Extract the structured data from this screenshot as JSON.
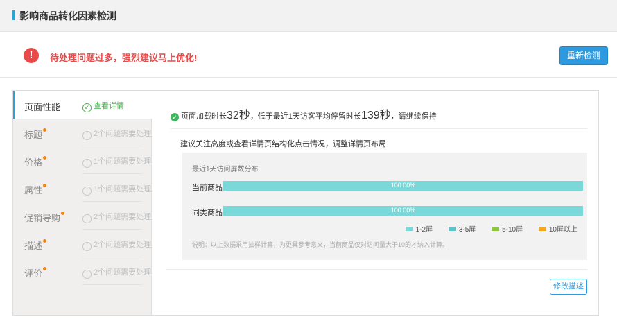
{
  "header": {
    "title": "影响商品转化因素检测",
    "accent_color": "#2aa3d8"
  },
  "alert": {
    "icon": "warning-icon",
    "message": "待处理问题过多，强烈建议马上优化!",
    "color": "#e84a4a",
    "recheck_label": "重新检测"
  },
  "sidebar": {
    "items": [
      {
        "label": "页面性能",
        "status": "查看详情",
        "active": true,
        "dot": false
      },
      {
        "label": "标题",
        "status": "2个问题需要处理",
        "active": false,
        "dot": true
      },
      {
        "label": "价格",
        "status": "1个问题需要处理",
        "active": false,
        "dot": true
      },
      {
        "label": "属性",
        "status": "1个问题需要处理",
        "active": false,
        "dot": true
      },
      {
        "label": "促销导购",
        "status": "2个问题需要处理",
        "active": false,
        "dot": true
      },
      {
        "label": "描述",
        "status": "2个问题需要处理",
        "active": false,
        "dot": true
      },
      {
        "label": "评价",
        "status": "2个问题需要处理",
        "active": false,
        "dot": true
      }
    ]
  },
  "main": {
    "summary": {
      "prefix": "页面加载时长",
      "load_time": "32秒",
      "middle": "，低于最近1天访客平均停留时长",
      "stay_time": "139秒",
      "suffix": "，请继续保持"
    },
    "advice": "建议关注高度或查看详情页结构化点击情况，调整详情页布局",
    "chart": {
      "title": "最近1天访问屏数分布",
      "rows": [
        {
          "label": "当前商品",
          "value_text": "100.00%"
        },
        {
          "label": "同类商品",
          "value_text": "100.00%"
        }
      ],
      "legend": [
        {
          "label": "1-2屏",
          "color": "#7ad8d8"
        },
        {
          "label": "3-5屏",
          "color": "#5bc4c8"
        },
        {
          "label": "5-10屏",
          "color": "#8cc63f"
        },
        {
          "label": "10屏以上",
          "color": "#f5a623"
        }
      ],
      "note": "说明：以上数据采用抽样计算，为更具参考意义，当前商品仅对访问量大于10的才纳入计算。"
    },
    "edit_label": "修改描述"
  },
  "chart_data": {
    "type": "bar",
    "title": "最近1天访问屏数分布",
    "categories": [
      "当前商品",
      "同类商品"
    ],
    "series": [
      {
        "name": "1-2屏",
        "values": [
          100,
          100
        ]
      },
      {
        "name": "3-5屏",
        "values": [
          0,
          0
        ]
      },
      {
        "name": "5-10屏",
        "values": [
          0,
          0
        ]
      },
      {
        "name": "10屏以上",
        "values": [
          0,
          0
        ]
      }
    ],
    "xlim": [
      0,
      100
    ],
    "unit": "%",
    "legend_position": "bottom-right"
  }
}
